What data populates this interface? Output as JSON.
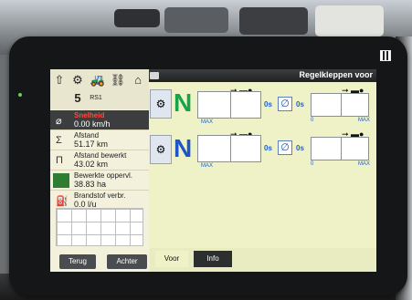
{
  "header": {
    "title": "Regelkleppen voor"
  },
  "iconbar": {
    "items": [
      {
        "name": "grid-arrow-icon",
        "glyph": "⇧"
      },
      {
        "name": "gear-icon",
        "glyph": "⚙"
      },
      {
        "name": "tractor-icon",
        "glyph": "🚜"
      },
      {
        "name": "link-icon",
        "glyph": "⛓"
      },
      {
        "name": "implement-icon",
        "glyph": "⌂"
      }
    ],
    "counter": "5",
    "badge": "RS1"
  },
  "stats": [
    {
      "label": "Snelheid",
      "value": "0.00 km/h",
      "icon": "⌀",
      "selected": true
    },
    {
      "label": "Afstand",
      "value": "51.17 km",
      "icon": "Σ",
      "selected": false
    },
    {
      "label": "Afstand bewerkt",
      "value": "43.02 km",
      "icon": "Π",
      "selected": false
    },
    {
      "label": "Bewerkte oppervl.",
      "value": "38.83 ha",
      "icon": "",
      "selected": false
    },
    {
      "label": "Brandstof verbr.",
      "value": "0.0 l/u",
      "icon": "⛽",
      "selected": false
    }
  ],
  "valves": [
    {
      "mode": "N",
      "mode_color": "#17a34a",
      "value_1": "0s",
      "value_2": "0s",
      "max_label": "MAX",
      "zero_label": "0",
      "max_label_right": "MAX"
    },
    {
      "mode": "N",
      "mode_color": "#1f55c8",
      "value_1": "0s",
      "value_2": "0s",
      "max_label": "MAX",
      "zero_label": "0",
      "max_label_right": "MAX"
    }
  ],
  "buttons": {
    "terug": "Terug",
    "achter": "Achter"
  },
  "tabs": [
    {
      "label": "Voor",
      "active": true
    },
    {
      "label": "Info",
      "active": false
    }
  ],
  "colors": {
    "screen_bg": "#eef2c6",
    "selected_label": "#ff4a3a"
  }
}
